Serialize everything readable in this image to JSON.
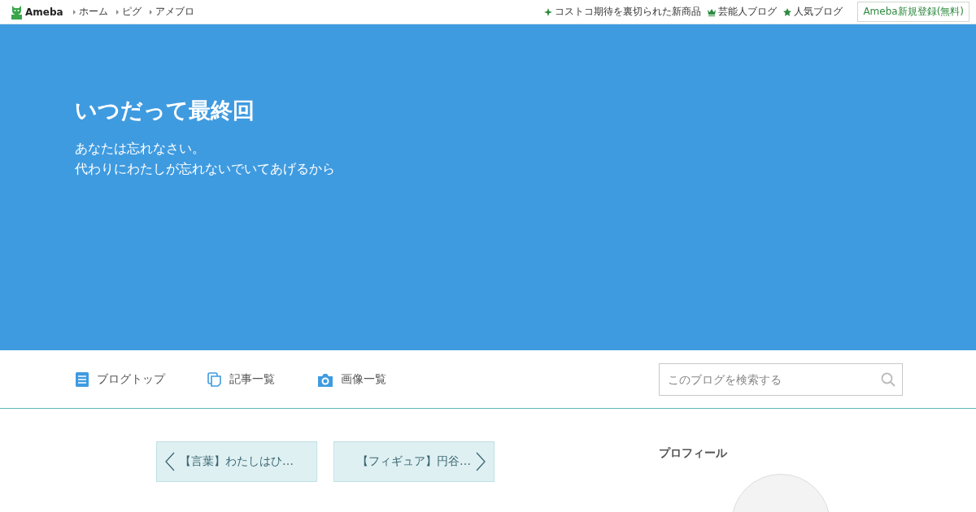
{
  "header": {
    "logo": "Ameba",
    "breadcrumbs": [
      "ホーム",
      "ピグ",
      "アメブロ"
    ],
    "links": [
      {
        "kind": "sparkle",
        "label": "コストコ期待を裏切られた新商品"
      },
      {
        "kind": "crown",
        "label": "芸能人ブログ"
      },
      {
        "kind": "star",
        "label": "人気ブログ"
      }
    ],
    "signup_button": "Ameba新規登録(無料)"
  },
  "blog": {
    "title": "いつだって最終回",
    "description": [
      "あなたは忘れなさい。",
      "代わりにわたしが忘れないでいてあげるから"
    ]
  },
  "nav": {
    "items": [
      {
        "kind": "top",
        "label": "ブログトップ"
      },
      {
        "kind": "list",
        "label": "記事一覧"
      },
      {
        "kind": "images",
        "label": "画像一覧"
      }
    ],
    "search": {
      "placeholder": "このブログを検索する"
    }
  },
  "pager": [
    {
      "kind": "prev",
      "label": "【言葉】わたしはひ…"
    },
    {
      "kind": "next",
      "label": "【フィギュア】円谷…"
    }
  ],
  "sidebar": {
    "title": "プロフィール"
  }
}
